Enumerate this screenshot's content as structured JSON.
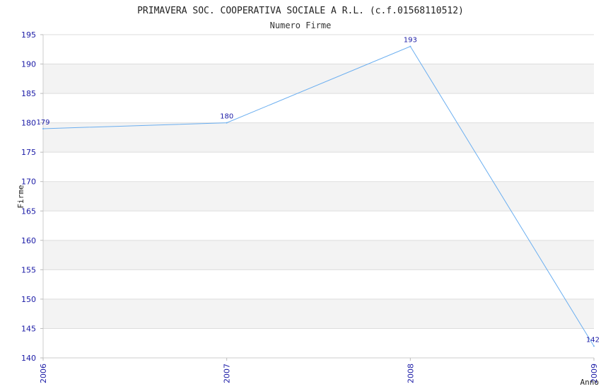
{
  "chart_data": {
    "type": "line",
    "title": "PRIMAVERA SOC. COOPERATIVA SOCIALE A R.L. (c.f.01568110512)",
    "subtitle": "Numero Firme",
    "xlabel": "Anno",
    "ylabel": "Firme",
    "categories": [
      "2006",
      "2007",
      "2008",
      "2009"
    ],
    "series": [
      {
        "values": [
          179,
          180,
          193,
          142
        ]
      }
    ],
    "y_ticks": [
      140,
      145,
      150,
      155,
      160,
      165,
      170,
      175,
      180,
      185,
      190,
      195
    ],
    "ylim": [
      140,
      195
    ],
    "grid": true,
    "line_color": "#6aaef0",
    "band_color": "#f3f3f3",
    "tick_color": "#1a1aa6"
  }
}
